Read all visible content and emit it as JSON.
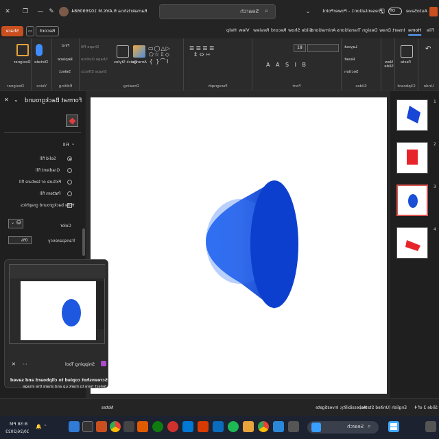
{
  "app": {
    "window_title": "Presentation1 - PowerPoint",
    "autosave_label": "AutoSave",
    "autosave_state": "Off",
    "user_name": "Ramakrishna R.AVK.M 102690684"
  },
  "search": {
    "placeholder": "Search"
  },
  "ribbon_tabs": [
    "File",
    "Home",
    "Insert",
    "Draw",
    "Design",
    "Transitions",
    "Animations",
    "Slide Show",
    "Record",
    "Review",
    "View",
    "Help"
  ],
  "active_tab": "Home",
  "ribbon_actions": {
    "share": "Share",
    "record": "Record"
  },
  "ribbon_groups": {
    "undo": "Undo",
    "clipboard": "Clipboard",
    "slides": "Slides",
    "font": "Font",
    "paragraph": "Paragraph",
    "drawing": "Drawing",
    "editing": "Editing",
    "voice": "Voice",
    "designer": "Designer"
  },
  "ribbon_buttons": {
    "paste": "Paste",
    "new_slide": "New Slide",
    "reuse_slides": "Reuse Slides",
    "layout": "Layout",
    "reset": "Reset",
    "section": "Section",
    "arrange": "Arrange",
    "quick_styles": "Quick Styles",
    "shape_fill": "Shape Fill",
    "shape_outline": "Shape Outline",
    "shape_effects": "Shape Effects",
    "find": "Find",
    "replace": "Replace",
    "select": "Select",
    "dictate": "Dictate",
    "designer": "Designer",
    "font_size": "18"
  },
  "format_panel": {
    "title": "Format Background",
    "section": "Fill",
    "options": [
      {
        "label": "Solid fill",
        "selected": true
      },
      {
        "label": "Gradient fill",
        "selected": false
      },
      {
        "label": "Picture or texture fill",
        "selected": false
      },
      {
        "label": "Pattern fill",
        "selected": false
      }
    ],
    "hide_graphics": "Hide background graphics",
    "color_label": "Color",
    "transparency_label": "Transparency",
    "transparency_value": "0%"
  },
  "snip": {
    "title": "Snipping Tool",
    "message_title": "Screenshot copied to clipboard and saved",
    "message_body": "Select here to mark up and share the image"
  },
  "thumbnails": [
    {
      "number": "1",
      "color": "#1846d6"
    },
    {
      "number": "2",
      "color": "#e8242b"
    },
    {
      "number": "3",
      "color": "#1a4fd6"
    },
    {
      "number": "4",
      "color": "#e8242b"
    }
  ],
  "status": {
    "slide_info": "Slide 3 of 4",
    "language": "English (United States)",
    "accessibility": "Accessibility: Investigate",
    "notes": "Notes"
  },
  "taskbar": {
    "search_placeholder": "Search",
    "time": "8:38 PM",
    "date": "10/26/2023"
  },
  "colors": {
    "accent": "#5aa0ff",
    "share_button": "#c94f1f",
    "cone_blue": "#1f58e0",
    "cone_dark": "#0b3cc4"
  }
}
